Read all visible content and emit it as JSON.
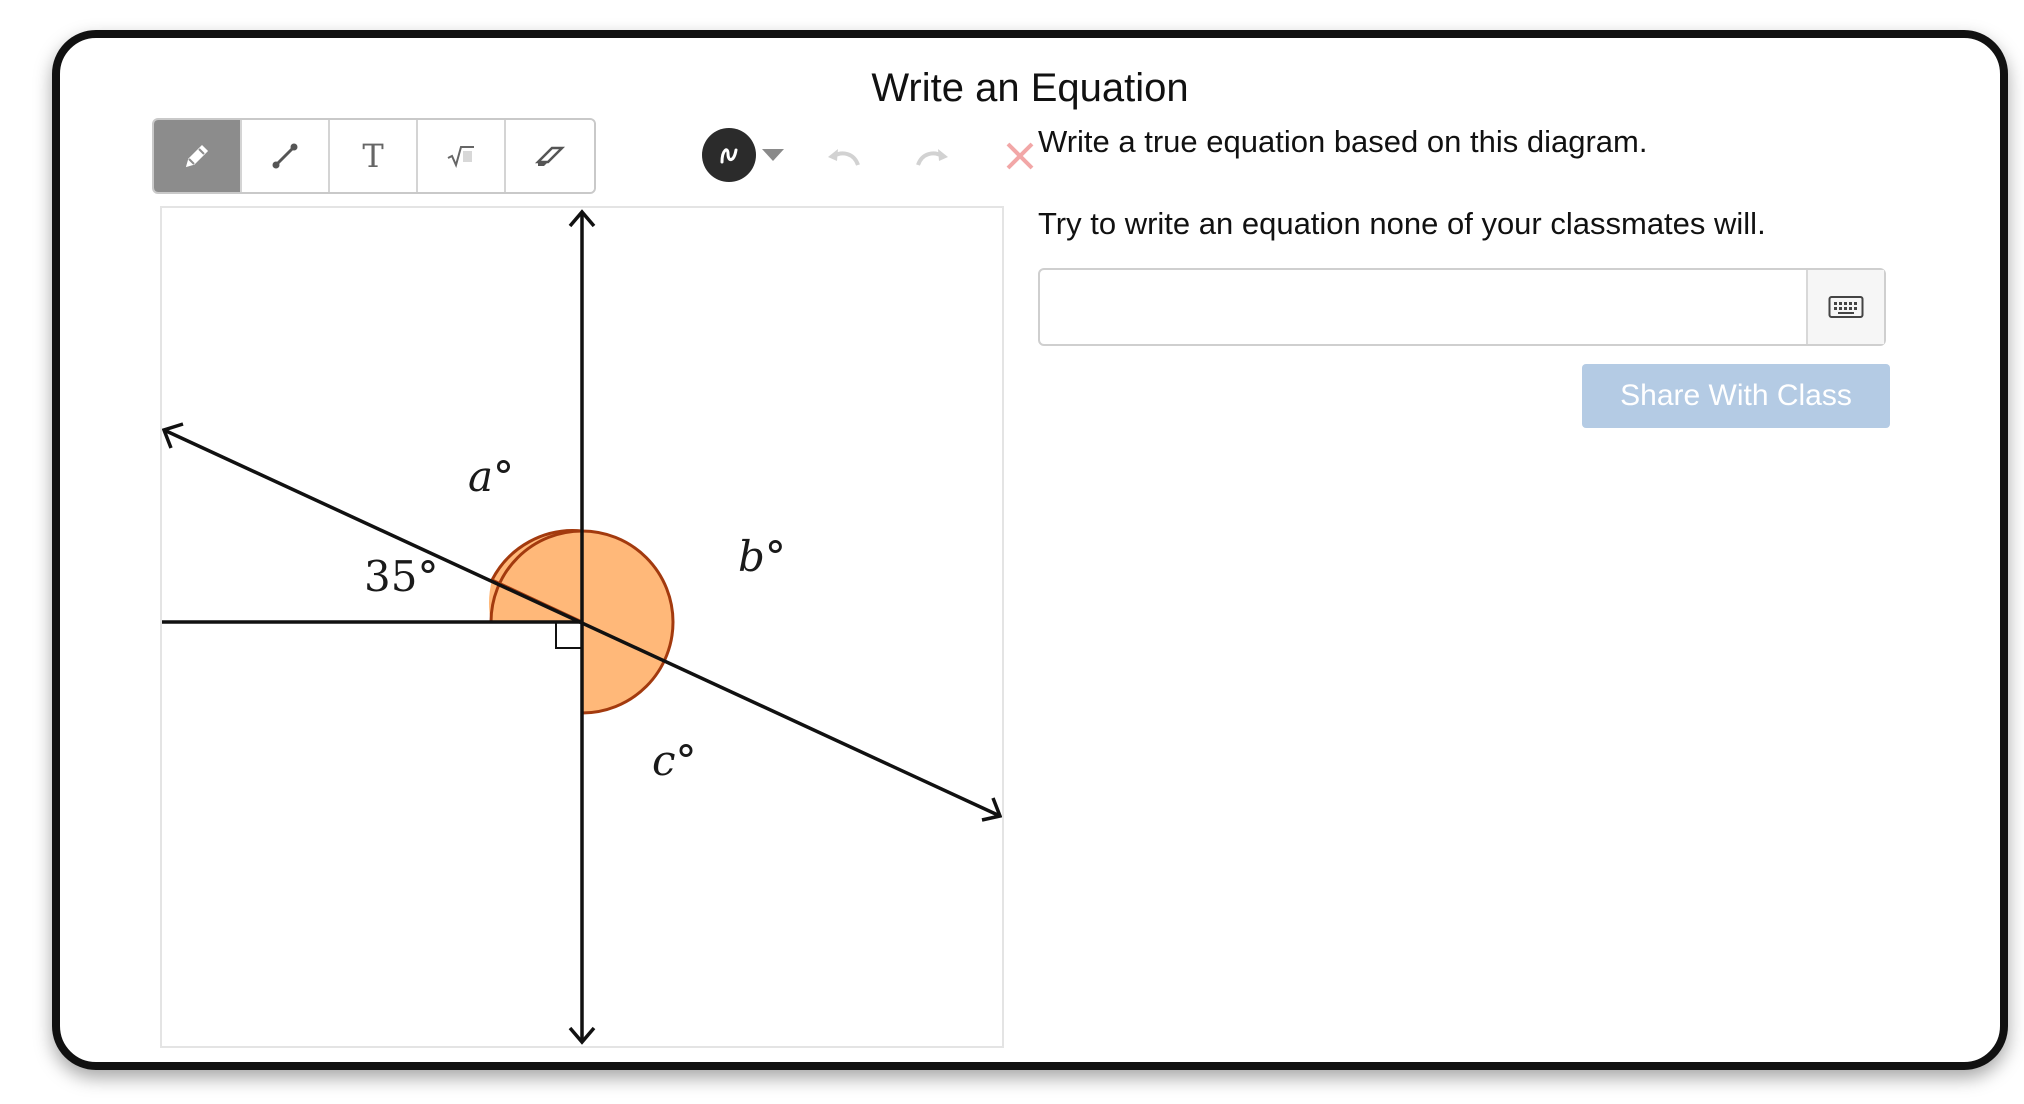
{
  "activity": {
    "title": "Write an Equation"
  },
  "toolbar": {
    "tools": [
      {
        "name": "pencil",
        "icon": "pencil-icon",
        "active": true
      },
      {
        "name": "line",
        "icon": "line-segment-icon",
        "active": false
      },
      {
        "name": "text",
        "icon": "text-icon",
        "label": "T",
        "active": false
      },
      {
        "name": "math",
        "icon": "square-root-icon",
        "active": false
      },
      {
        "name": "eraser",
        "icon": "eraser-icon",
        "active": false
      }
    ],
    "color": "#2b2b2b",
    "undo_icon": "undo-icon",
    "redo_icon": "redo-icon",
    "clear_icon": "close-icon",
    "clear_color": "#f2a7a7"
  },
  "diagram": {
    "labels": {
      "a": "a°",
      "b": "b°",
      "c": "c°",
      "given": "35°"
    },
    "shaded_color": "#ffb879",
    "shaded_stroke": "#a33a0e"
  },
  "question": {
    "prompt": "Write a true equation based on this diagram.",
    "hint": "Try to write an equation none of your classmates will.",
    "answer_value": "",
    "keyboard_icon": "keyboard-icon",
    "share_label": "Share With Class",
    "share_color": "#b4cbe4"
  }
}
